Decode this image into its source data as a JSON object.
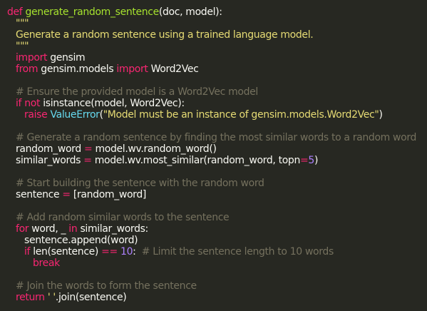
{
  "code": {
    "l1": {
      "kw": "def",
      "fn": "generate_random_sentence",
      "args": "(doc, model):"
    },
    "l2": "\"\"\"",
    "l3": "Generate a random sentence using a trained language model.",
    "l4": "\"\"\"",
    "l5": {
      "kw": "import",
      "rest": " gensim"
    },
    "l6": {
      "kw1": "from",
      "mid": " gensim.models ",
      "kw2": "import",
      "rest": " Word2Vec"
    },
    "l8": "# Ensure the provided model is a Word2Vec model",
    "l9": {
      "kw1": "if",
      "kw2": "not",
      "rest": " isinstance(model, Word2Vec):"
    },
    "l10": {
      "kw": "raise",
      "exc": "ValueError",
      "open": "(",
      "str": "\"Model must be an instance of gensim.models.Word2Vec\"",
      "close": ")"
    },
    "l12": "# Generate a random sentence by finding the most similar words to a random word",
    "l13": {
      "a": "random_word",
      "eq": "=",
      "b": " model.wv.random_word()"
    },
    "l14": {
      "a": "similar_words",
      "eq": "=",
      "b": " model.wv.most_similar(random_word, topn",
      "eq2": "=",
      "num": "5",
      "c": ")"
    },
    "l16": "# Start building the sentence with the random word",
    "l17": {
      "a": "sentence",
      "eq": "=",
      "b": " [random_word]"
    },
    "l19": "# Add random similar words to the sentence",
    "l20": {
      "kw": "for",
      "a": " word, _ ",
      "kw2": "in",
      "b": " similar_words:"
    },
    "l21": "sentence.append(word)",
    "l22": {
      "kw": "if",
      "a": " len(sentence) ",
      "op": "==",
      "num": "10",
      "b": ":  ",
      "cm": "# Limit the sentence length to 10 words"
    },
    "l23": "break",
    "l25": "# Join the words to form the sentence",
    "l26": {
      "kw": "return",
      "str": " ' '",
      "rest": ".join(sentence)"
    }
  }
}
